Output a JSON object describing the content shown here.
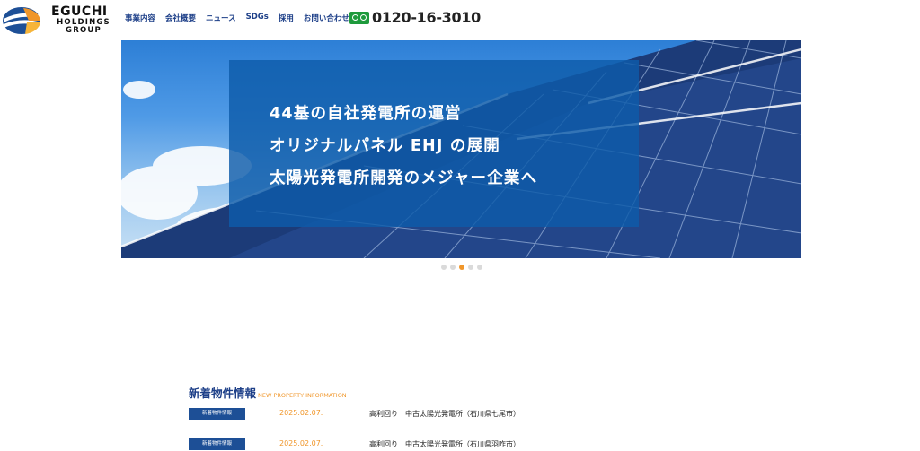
{
  "brand": {
    "name": "EGUCHI",
    "line2": "HOLDINGS",
    "line3": "GROUP",
    "colors": {
      "blue": "#1d4f96",
      "orange": "#f0962a",
      "green": "#1e9a3c"
    }
  },
  "nav": {
    "items": [
      {
        "label": "事業内容"
      },
      {
        "label": "会社概要"
      },
      {
        "label": "ニュース"
      },
      {
        "label": "SDGs"
      },
      {
        "label": "採用"
      },
      {
        "label": "お問い合わせ"
      }
    ]
  },
  "phone": {
    "icon": "freedial-icon",
    "number": "0120-16-3010"
  },
  "hero": {
    "lines": [
      "44基の自社発電所の運営",
      "オリジナルパネル EHJ の展開",
      "太陽光発電所開発のメジャー企業へ"
    ]
  },
  "slider": {
    "slide_count": 5,
    "active_index": 2
  },
  "news": {
    "title": "新着物件情報",
    "title_en": "NEW PROPERTY INFORMATION",
    "rows": [
      {
        "badge": "新着物件情報",
        "date": "2025.02.07.",
        "text": "高利回り　中古太陽光発電所（石川県七尾市）"
      },
      {
        "badge": "新着物件情報",
        "date": "2025.02.07.",
        "text": "高利回り　中古太陽光発電所（石川県羽咋市）"
      }
    ]
  }
}
